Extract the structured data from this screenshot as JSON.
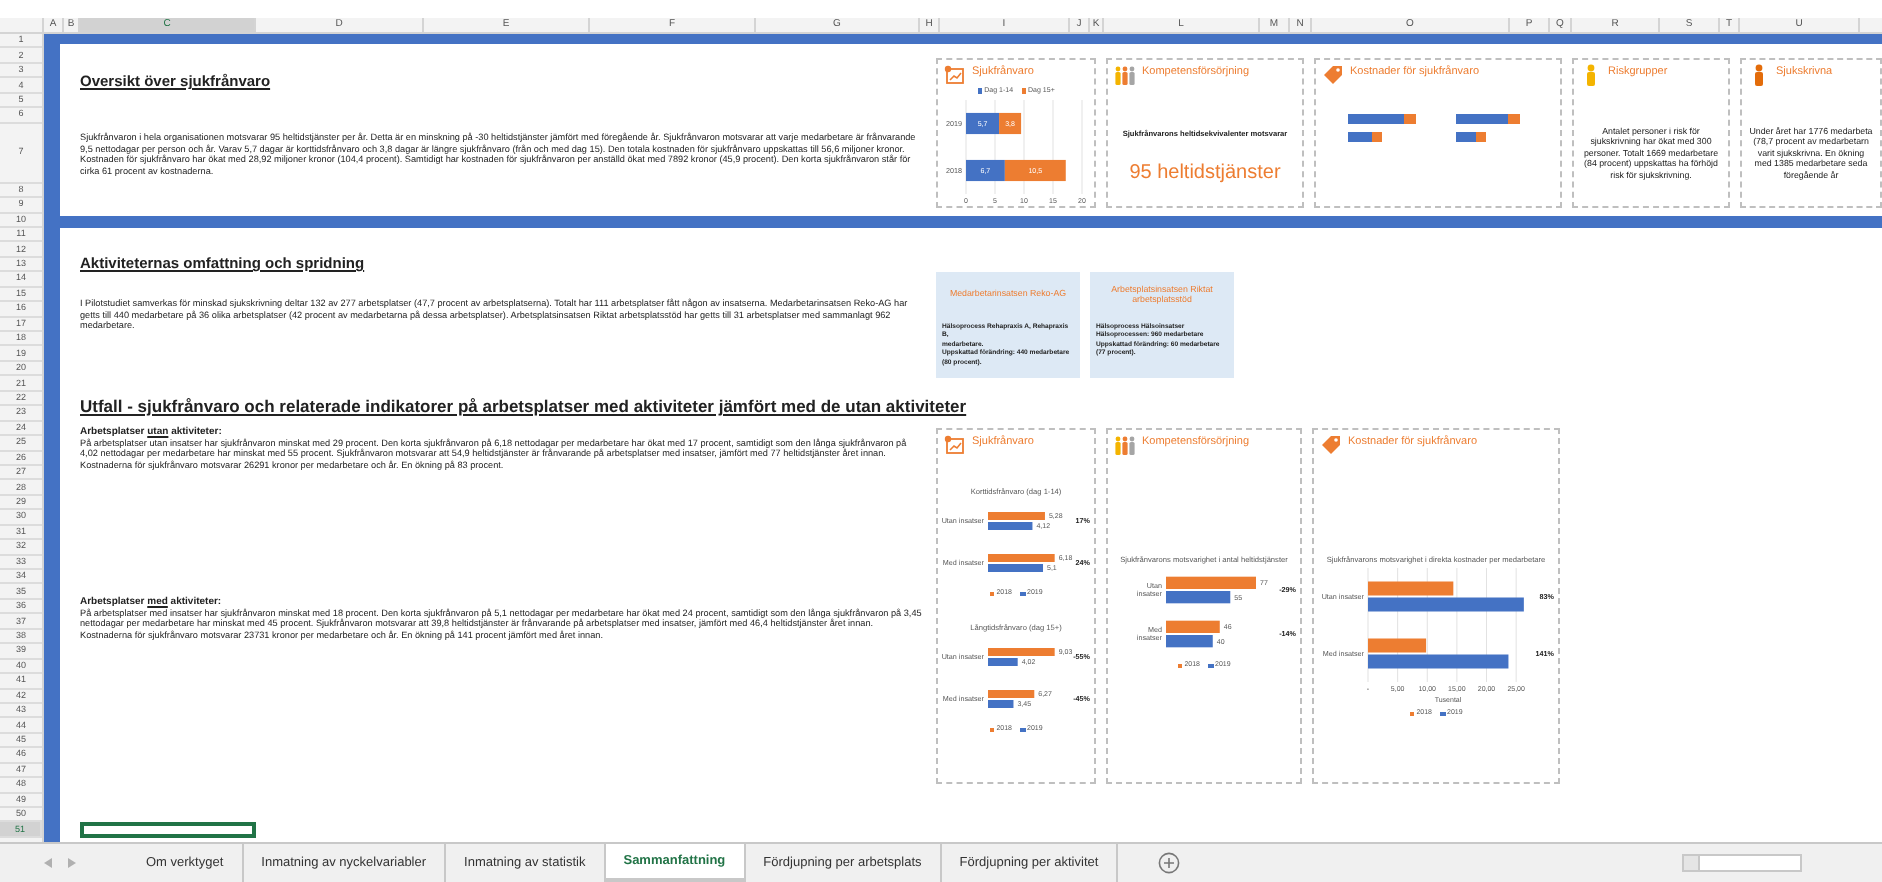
{
  "columns": [
    {
      "label": "A",
      "selected": false
    },
    {
      "label": "B",
      "selected": false
    },
    {
      "label": "C",
      "selected": true
    },
    {
      "label": "D",
      "selected": false
    },
    {
      "label": "E",
      "selected": false
    },
    {
      "label": "F",
      "selected": false
    },
    {
      "label": "G",
      "selected": false
    },
    {
      "label": "H",
      "selected": false
    },
    {
      "label": "I",
      "selected": false
    },
    {
      "label": "J",
      "selected": false
    },
    {
      "label": "K",
      "selected": false
    },
    {
      "label": "L",
      "selected": false
    },
    {
      "label": "M",
      "selected": false
    },
    {
      "label": "N",
      "selected": false
    },
    {
      "label": "O",
      "selected": false
    },
    {
      "label": "P",
      "selected": false
    },
    {
      "label": "Q",
      "selected": false
    },
    {
      "label": "R",
      "selected": false
    },
    {
      "label": "S",
      "selected": false
    },
    {
      "label": "T",
      "selected": false
    },
    {
      "label": "U",
      "selected": false
    }
  ],
  "rows": [
    {
      "label": "1",
      "selected": false
    },
    {
      "label": "2",
      "selected": false
    },
    {
      "label": "3",
      "selected": false
    },
    {
      "label": "4",
      "selected": false
    },
    {
      "label": "5",
      "selected": false
    },
    {
      "label": "6",
      "selected": false
    },
    {
      "label": "7",
      "selected": false
    },
    {
      "label": "8",
      "selected": false
    },
    {
      "label": "9",
      "selected": false
    },
    {
      "label": "10",
      "selected": false
    },
    {
      "label": "11",
      "selected": false
    },
    {
      "label": "12",
      "selected": false
    },
    {
      "label": "13",
      "selected": false
    },
    {
      "label": "14",
      "selected": false
    },
    {
      "label": "15",
      "selected": false
    },
    {
      "label": "16",
      "selected": false
    },
    {
      "label": "17",
      "selected": false
    },
    {
      "label": "18",
      "selected": false
    },
    {
      "label": "19",
      "selected": false
    },
    {
      "label": "20",
      "selected": false
    },
    {
      "label": "21",
      "selected": false
    },
    {
      "label": "22",
      "selected": false
    },
    {
      "label": "23",
      "selected": false
    },
    {
      "label": "24",
      "selected": false
    },
    {
      "label": "25",
      "selected": false
    },
    {
      "label": "26",
      "selected": false
    },
    {
      "label": "27",
      "selected": false
    },
    {
      "label": "28",
      "selected": false
    },
    {
      "label": "29",
      "selected": false
    },
    {
      "label": "30",
      "selected": false
    },
    {
      "label": "31",
      "selected": false
    },
    {
      "label": "32",
      "selected": false
    },
    {
      "label": "33",
      "selected": false
    },
    {
      "label": "34",
      "selected": false
    },
    {
      "label": "35",
      "selected": false
    },
    {
      "label": "36",
      "selected": false
    },
    {
      "label": "37",
      "selected": false
    },
    {
      "label": "38",
      "selected": false
    },
    {
      "label": "39",
      "selected": false
    },
    {
      "label": "40",
      "selected": false
    },
    {
      "label": "41",
      "selected": false
    },
    {
      "label": "42",
      "selected": false
    },
    {
      "label": "43",
      "selected": false
    },
    {
      "label": "44",
      "selected": false
    },
    {
      "label": "45",
      "selected": false
    },
    {
      "label": "46",
      "selected": false
    },
    {
      "label": "47",
      "selected": false
    },
    {
      "label": "48",
      "selected": false
    },
    {
      "label": "49",
      "selected": false
    },
    {
      "label": "50",
      "selected": false
    },
    {
      "label": "51",
      "selected": true
    }
  ],
  "overview": {
    "heading": "Oversikt över sjukfrånvaro",
    "text": "Sjukfrånvaron i hela organisationen motsvarar 95 heltidstjänster per år. Detta är en minskning på -30 heltidstjänster jämfört med föregående år. Sjukfrånvaron motsvarar att varje medarbetare är frånvarande 9,5 nettodagar per person och år. Varav 5,7 dagar är korttidsfrånvaro och 3,8 dagar är längre sjukfrånvaro (från och med dag 15). Den totala kostnaden för sjukfrånvaro uppskattas till 56,6 miljoner kronor. Kostnaden för sjukfrånvaro har ökat med 28,92 miljoner kronor (104,4 procent). Samtidigt har kostnaden för sjukfrånvaron per anställd ökat med 7892 kronor (45,9 procent). Den korta sjukfrånvaron står för cirka 61 procent av kostnaderna.",
    "cards": [
      {
        "kind": "chart",
        "title": "Sjukfrånvaro",
        "chart_data": {
          "type": "bar",
          "orientation": "horizontal",
          "stacked": true,
          "grid": true,
          "legend": "top",
          "data_labels": true,
          "categories": [
            "2019",
            "2018"
          ],
          "series": [
            {
              "name": "Dag 1-14",
              "color": "#4472c4",
              "values": [
                5.7,
                6.7
              ],
              "value_labels": [
                "5,7",
                "6,7"
              ]
            },
            {
              "name": "Dag 15+",
              "color": "#ed7d31",
              "values": [
                3.8,
                10.5
              ],
              "value_labels": [
                "3,8",
                "10,5"
              ]
            }
          ],
          "xlim": [
            0,
            20
          ],
          "xticks": [
            0,
            5,
            10,
            15,
            20
          ]
        }
      },
      {
        "kind": "figure",
        "title": "Kompetensförsörjning",
        "caption": "Sjukfrånvarons heltidsekvivalenter motsvarar",
        "figure": "95 heltidstjänster"
      },
      {
        "kind": "minicharts",
        "title": "Kostnader för sjukfrånvaro"
      },
      {
        "kind": "text",
        "title": "Riskgrupper",
        "text": "Antalet personer i risk för sjukskrivning har ökat med 300 personer. Totalt 1669 medarbetare (84 procent) uppskattas ha förhöjd risk för sjukskrivning."
      },
      {
        "kind": "lines",
        "title": "Sjukskrivna",
        "lines": [
          "Under året har 1776 medarbeta",
          "(78,7 procent av medarbetarn",
          "varit sjukskrivna. En ökning",
          "med 1385 medarbetare seda",
          "föregående år"
        ]
      }
    ]
  },
  "activities": {
    "heading": "Aktiviteternas omfattning och spridning",
    "text": "I Pilotstudiet samverkas för minskad sjukskrivning deltar 132 av 277 arbetsplatser (47,7 procent av arbetsplatserna). Totalt har 111 arbetsplatser fått någon av insatserna. Medarbetarinsatsen Reko-AG har getts till 440 medarbetare på 36 olika arbetsplatser (42 procent av medarbetarna på dessa arbetsplatser). Arbetsplatsinsatsen Riktat arbetsplatsstöd har getts till 31 arbetsplatser med sammanlagt 962 medarbetare.",
    "boxes": [
      {
        "title": "Medarbetarinsatsen Reko-AG",
        "lines": [
          "Hälsoprocess Rehapraxis A, Rehapraxis B,",
          "medarbetare.",
          "Uppskattad förändring: 440 medarbetare",
          "(80 procent)."
        ]
      },
      {
        "title": "Arbetsplatsinsatsen Riktat arbetsplatsstöd",
        "lines": [
          "Hälsoprocess Hälsoinsatser",
          "Hälsoprocessen: 960 medarbetare",
          "Uppskattad förändring: 60 medarbetare",
          "(77 procent)."
        ]
      }
    ]
  },
  "outcome": {
    "heading": "Utfall - sjukfrånvaro och relaterade indikatorer på arbetsplatser med aktiviteter jämfört med de utan aktiviteter",
    "blocks": [
      {
        "label_before": "Arbetsplatser",
        "label_emphasis": "utan",
        "label_after": "aktiviteter:",
        "text": "På arbetsplatser utan insatser har sjukfrånvaron minskat med 29 procent. Den korta sjukfrånvaron på 6,18 nettodagar per medarbetare har ökat med 17 procent, samtidigt som den långa sjukfrånvaron på 4,02 nettodagar per medarbetare har minskat med 55 procent. Sjukfrånvaron motsvarar att 54,9 heltidstjänster är frånvarande på arbetsplatser med insatser, jämfört med 77 heltidstjänster året innan. Kostnaderna för sjukfrånvaro motsvarar 26291 kronor per medarbetare och år. En ökning på 83 procent."
      },
      {
        "label_before": "Arbetsplatser",
        "label_emphasis": "med",
        "label_after": "aktiviteter:",
        "text": "På arbetsplatser med insatser har sjukfrånvaron minskat med 18 procent. Den korta sjukfrånvaron på 5,1 nettodagar per medarbetare har ökat med 24 procent, samtidigt som den långa sjukfrånvaron på 3,45 nettodagar per medarbetare har minskat med 45 procent. Sjukfrånvaron motsvarar att 39,8 heltidstjänster är frånvarande på arbetsplatser med insatser, jämfört med 46,4 heltidstjänster året innan. Kostnaderna för sjukfrånvaro motsvarar 23731 kronor per medarbetare och år. En ökning på 141 procent jämfört med året innan."
      }
    ],
    "cards": [
      {
        "title": "Sjukfrånvaro",
        "charts": [
          {
            "chart_data": {
              "type": "bar",
              "orientation": "horizontal",
              "legend": "bottom",
              "data_labels": true,
              "title": "Korttidsfrånvaro (dag 1-14)",
              "categories": [
                "Utan insatser",
                "Med insatser"
              ],
              "series": [
                {
                  "name": "2018",
                  "color": "#ed7d31",
                  "values": [
                    5.28,
                    6.18
                  ],
                  "value_labels": [
                    "5,28",
                    "6,18"
                  ]
                },
                {
                  "name": "2019",
                  "color": "#4472c4",
                  "values": [
                    4.12,
                    5.1
                  ],
                  "value_labels": [
                    "4,12",
                    "5,1"
                  ]
                }
              ],
              "annotations": [
                {
                  "text": "17%"
                },
                {
                  "text": "24%"
                }
              ]
            }
          },
          {
            "chart_data": {
              "type": "bar",
              "orientation": "horizontal",
              "legend": "bottom",
              "data_labels": true,
              "title": "Långtidsfrånvaro (dag 15+)",
              "categories": [
                "Utan insatser",
                "Med insatser"
              ],
              "series": [
                {
                  "name": "2018",
                  "color": "#ed7d31",
                  "values": [
                    9.03,
                    6.27
                  ],
                  "value_labels": [
                    "9,03",
                    "6,27"
                  ]
                },
                {
                  "name": "2019",
                  "color": "#4472c4",
                  "values": [
                    4.02,
                    3.45
                  ],
                  "value_labels": [
                    "4,02",
                    "3,45"
                  ]
                }
              ],
              "annotations": [
                {
                  "text": "-55%"
                },
                {
                  "text": "-45%"
                }
              ]
            }
          }
        ]
      },
      {
        "title": "Kompetensförsörjning",
        "charts": [
          {
            "chart_data": {
              "type": "bar",
              "orientation": "horizontal",
              "legend": "bottom",
              "data_labels": true,
              "title": "Sjukfrånvarons motsvarighet i antal heltidstjänster",
              "categories": [
                "Utan insatser",
                "Med insatser"
              ],
              "series": [
                {
                  "name": "2018",
                  "color": "#ed7d31",
                  "values": [
                    77,
                    46
                  ]
                },
                {
                  "name": "2019",
                  "color": "#4472c4",
                  "values": [
                    55,
                    40
                  ]
                }
              ],
              "annotations": [
                {
                  "text": "-29%"
                },
                {
                  "text": "-14%"
                }
              ]
            }
          }
        ]
      },
      {
        "title": "Kostnader för sjukfrånvaro",
        "charts": [
          {
            "chart_data": {
              "type": "bar",
              "orientation": "horizontal",
              "grid": true,
              "legend": "bottom",
              "title": "Sjukfrånvarons motsvarighet i direkta kostnader per medarbetare",
              "categories": [
                "Utan insatser",
                "Med insatser"
              ],
              "series": [
                {
                  "name": "2018",
                  "color": "#ed7d31",
                  "values": [
                    14.4,
                    9.8
                  ]
                },
                {
                  "name": "2019",
                  "color": "#4472c4",
                  "values": [
                    26.3,
                    23.7
                  ]
                }
              ],
              "xlim": [
                0,
                27
              ],
              "xticks": [
                {
                  "value": 0,
                  "label": "-"
                },
                {
                  "value": 5,
                  "label": "5,00"
                },
                {
                  "value": 10,
                  "label": "10,00"
                },
                {
                  "value": 15,
                  "label": "15,00"
                },
                {
                  "value": 20,
                  "label": "20,00"
                },
                {
                  "value": 25,
                  "label": "25,00"
                }
              ],
              "xlabel": "Tusental",
              "annotations": [
                {
                  "text": "83%"
                },
                {
                  "text": "141%"
                }
              ]
            }
          }
        ]
      }
    ]
  },
  "sheet_tabs": [
    {
      "label": "Om verktyget",
      "selected": false
    },
    {
      "label": "Inmatning av nyckelvariabler",
      "selected": false
    },
    {
      "label": "Inmatning av statistik",
      "selected": false
    },
    {
      "label": "Sammanfattning",
      "selected": true
    },
    {
      "label": "Fördjupning per arbetsplats",
      "selected": false
    },
    {
      "label": "Fördjupning per aktivitet",
      "selected": false
    }
  ]
}
